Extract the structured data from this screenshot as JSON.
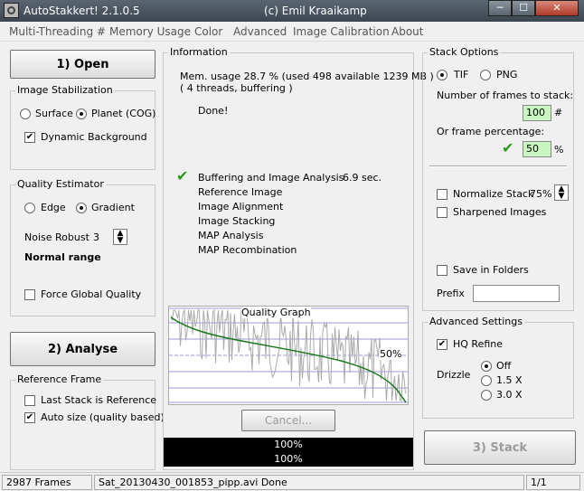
{
  "window": {
    "title": "AutoStakkert! 2.1.0.5",
    "author": "(c) Emil Kraaikamp",
    "min_glyph": "─",
    "max_glyph": "☐",
    "close_glyph": "✕"
  },
  "menu": [
    "Multi-Threading #",
    "Memory Usage",
    "Color",
    "Advanced",
    "Image Calibration",
    "About"
  ],
  "left": {
    "open_button": "1) Open",
    "stabilization": {
      "title": "Image Stabilization",
      "surface": "Surface",
      "planet": "Planet (COG)",
      "dynamic_bg": "Dynamic Background",
      "selected": "planet",
      "dynamic_bg_checked": true
    },
    "quality": {
      "title": "Quality Estimator",
      "edge": "Edge",
      "gradient": "Gradient",
      "selected": "gradient",
      "noise_label": "Noise Robust",
      "noise_value": "3",
      "range_text": "Normal range",
      "force_global": "Force Global Quality",
      "force_global_checked": false
    },
    "analyse_button": "2) Analyse",
    "reference": {
      "title": "Reference Frame",
      "last_stack": "Last Stack is Reference",
      "auto_size": "Auto size (quality based)",
      "last_stack_checked": false,
      "auto_size_checked": true
    }
  },
  "info": {
    "title": "Information",
    "mem_line1": "Mem. usage 28.7 %  (used 498 available 1239 MB )",
    "mem_line2": "( 4 threads, buffering )",
    "done": "Done!",
    "steps": [
      {
        "label": "Buffering and Image Analysis",
        "time": "6.9 sec.",
        "done": true
      },
      {
        "label": "Reference Image",
        "time": "",
        "done": false
      },
      {
        "label": "Image Alignment",
        "time": "",
        "done": false
      },
      {
        "label": "Image Stacking",
        "time": "",
        "done": false
      },
      {
        "label": "MAP Analysis",
        "time": "",
        "done": false
      },
      {
        "label": "MAP Recombination",
        "time": "",
        "done": false
      }
    ],
    "graph_title": "Quality Graph",
    "graph_marker": "50%",
    "graph_marker_fraction": 0.5,
    "cancel_button": "Cancel...",
    "progress": [
      {
        "text": "100%",
        "value": 100
      },
      {
        "text": "100%",
        "value": 100
      }
    ]
  },
  "stack": {
    "title": "Stack Options",
    "tif": "TIF",
    "png": "PNG",
    "format_selected": "tif",
    "frames_label": "Number of frames to stack:",
    "frames_value": "100",
    "frames_unit": "#",
    "pct_label": "Or frame percentage:",
    "pct_value": "50",
    "pct_unit": "%",
    "normalize": "Normalize Stack",
    "normalize_value": "75%",
    "normalize_checked": false,
    "sharpened": "Sharpened Images",
    "sharpened_checked": false,
    "save_folders": "Save in Folders",
    "save_folders_checked": false,
    "prefix_label": "Prefix",
    "prefix_value": ""
  },
  "advanced": {
    "title": "Advanced Settings",
    "hq_refine": "HQ Refine",
    "hq_refine_checked": true,
    "drizzle_label": "Drizzle",
    "drizzle_options": [
      "Off",
      "1.5 X",
      "3.0 X"
    ],
    "drizzle_selected": 0
  },
  "stack_button": "3) Stack",
  "status": {
    "frames": "2987 Frames",
    "file": "Sat_20130430_001853_pipp.avi   Done",
    "page": "1/1"
  }
}
